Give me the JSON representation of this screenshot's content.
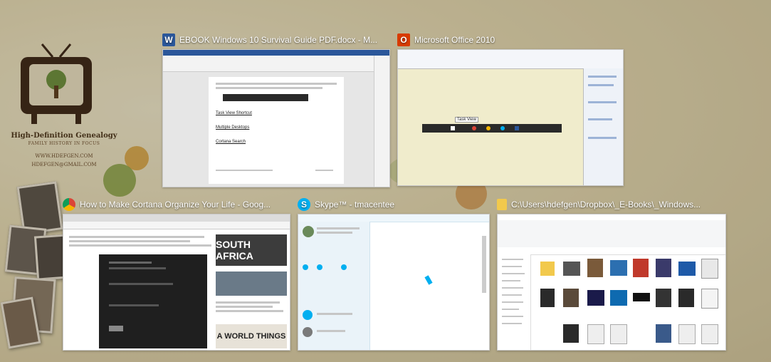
{
  "wallpaper": {
    "title": "High-Definition Genealogy",
    "subtitle": "FAMILY HISTORY IN FOCUS",
    "website": "WWW.HDEFGEN.COM",
    "email": "HDEFGEN@GMAIL.COM"
  },
  "windows": [
    {
      "title": "EBOOK Windows 10 Survival Guide PDF.docx - M...",
      "icon": "word-icon",
      "icon_color": "#2b579a",
      "icon_glyph": "W",
      "content": {
        "link1": "Task View Shortcut",
        "link2": "Multiple Desktops",
        "link3": "Cortana Search"
      }
    },
    {
      "title": "Microsoft Office 2010",
      "icon": "office-icon",
      "icon_color": "#d83b01",
      "icon_glyph": "O",
      "content": {
        "tooltip": "Task View"
      }
    },
    {
      "title": "How to Make Cortana Organize Your Life - Goog...",
      "icon": "chrome-icon",
      "icon_color": "#db4437",
      "icon_glyph": "",
      "content": {
        "ad1": "SOUTH AFRICA",
        "ad2": "A WORLD THINGS"
      }
    },
    {
      "title": "Skype™ - tmacentee",
      "icon": "skype-icon",
      "icon_color": "#00aff0",
      "icon_glyph": "S",
      "content": {}
    },
    {
      "title": "C:\\Users\\hdefgen\\Dropbox\\_E-Books\\_Windows...",
      "icon": "folder-icon",
      "icon_color": "#f2c94c",
      "icon_glyph": "",
      "content": {}
    }
  ]
}
